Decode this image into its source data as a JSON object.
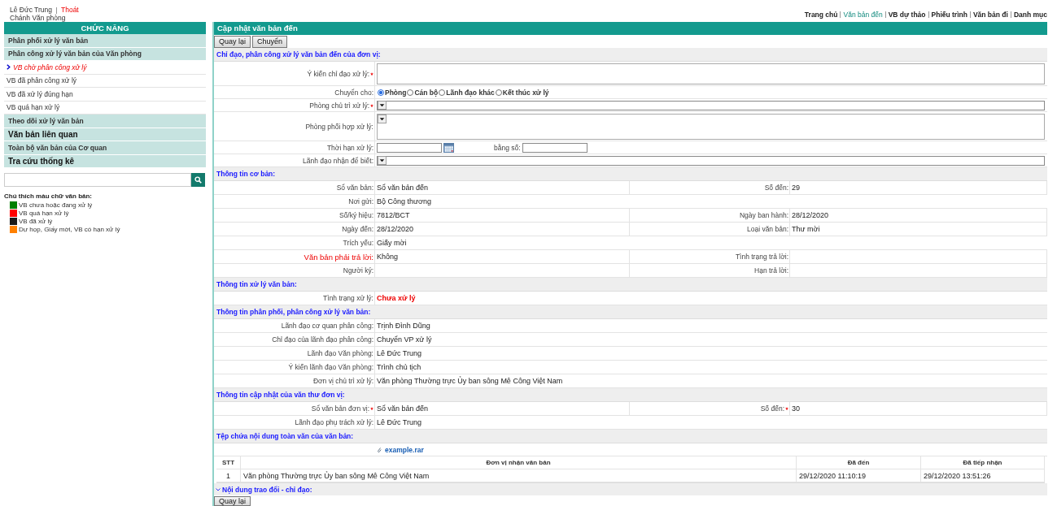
{
  "user": {
    "name": "Lê Đức Trung",
    "logout": "Thoát",
    "role": "Chánh Văn phòng"
  },
  "nav": [
    {
      "label": "Trang chủ",
      "selected": false
    },
    {
      "label": "Văn bản đến",
      "selected": true
    },
    {
      "label": "VB dự thảo",
      "selected": false
    },
    {
      "label": "Phiếu trình",
      "selected": false
    },
    {
      "label": "Văn bản đi",
      "selected": false
    },
    {
      "label": "Danh mục",
      "selected": false
    }
  ],
  "sidebar": {
    "title": "CHỨC NĂNG",
    "items": [
      {
        "label": "Phân phối xử lý văn bản",
        "kind": "group",
        "selected": false
      },
      {
        "label": "Phân công xử lý văn bản của Văn phòng",
        "kind": "group",
        "selected": false
      },
      {
        "label": "VB chờ phân công xử lý",
        "kind": "item",
        "selected": true
      },
      {
        "label": "VB đã phân công xử lý",
        "kind": "item",
        "selected": false
      },
      {
        "label": "VB đã xử lý đúng hạn",
        "kind": "item",
        "selected": false
      },
      {
        "label": "VB quá hạn xử lý",
        "kind": "item",
        "selected": false
      },
      {
        "label": "Theo dõi xử lý văn bản",
        "kind": "group",
        "selected": false
      },
      {
        "label": "Văn bản liên quan",
        "kind": "major",
        "selected": false
      },
      {
        "label": "Toàn bộ văn bản của Cơ quan",
        "kind": "group",
        "selected": false
      },
      {
        "label": "Tra cứu thống kê",
        "kind": "major",
        "selected": false
      }
    ],
    "legend": {
      "title": "Chú thích màu chữ văn bản:",
      "items": [
        {
          "label": "VB chưa hoặc đang xử lý",
          "color": "#008000"
        },
        {
          "label": "VB quá hạn xử lý",
          "color": "#ff0000"
        },
        {
          "label": "VB đã xử lý",
          "color": "#1a1a1a"
        },
        {
          "label": "Dự họp, Giấy mời, VB có hạn xử lý",
          "color": "#ff8000"
        }
      ]
    }
  },
  "main": {
    "title": "Cập nhật văn bản đến",
    "buttons": [
      "Quay lại",
      "Chuyển"
    ],
    "form": {
      "heading": "Chỉ đạo, phân công xử lý văn bản đến của đơn vị:",
      "fields": [
        {
          "label": "Ý kiến chỉ đạo xử lý:",
          "kind": "textarea",
          "required": true
        },
        {
          "label": "Chuyển cho:",
          "kind": "radios",
          "required": false,
          "options": [
            {
              "label": "Phòng",
              "selected": true
            },
            {
              "label": "Cán bộ",
              "selected": false
            },
            {
              "label": "Lãnh đạo khác",
              "selected": false
            },
            {
              "label": "Kết thúc xử lý",
              "selected": false
            }
          ]
        },
        {
          "label": "Phòng chủ trì xử lý:",
          "kind": "select",
          "required": true
        },
        {
          "label": "Phòng phối hợp xử lý:",
          "kind": "listbox",
          "required": false
        },
        {
          "label": "Thời hạn xử lý:",
          "kind": "date",
          "required": false,
          "extra_label": "bằng số:"
        },
        {
          "label": "Lãnh đạo nhận để biết:",
          "kind": "select",
          "required": false
        }
      ]
    },
    "sections": [
      {
        "kind": "fields",
        "heading": "Thông tin cơ bản:",
        "rows": [
          {
            "cells": [
              {
                "label": "Sổ văn bản:",
                "value": "Sổ văn bản đến"
              },
              {
                "label": "Số đến:",
                "value": "29"
              }
            ]
          },
          {
            "cells": [
              {
                "label": "Nơi gửi:",
                "value": "Bộ Công thương"
              }
            ]
          },
          {
            "cells": [
              {
                "label": "Số/ký hiệu:",
                "value": "7812/BCT"
              },
              {
                "label": "Ngày ban hành:",
                "value": "28/12/2020"
              }
            ]
          },
          {
            "cells": [
              {
                "label": "Ngày đến:",
                "value": "28/12/2020"
              },
              {
                "label": "Loại văn bản:",
                "value": "Thư mời"
              }
            ]
          },
          {
            "cells": [
              {
                "label": "Trích yếu:",
                "value": "Giấy mời"
              }
            ]
          },
          {
            "cells": [
              {
                "label": "Văn bản phải trả lời:",
                "value": "Không",
                "label_alert": true
              },
              {
                "label": "Tình trạng trả lời:"
              }
            ]
          },
          {
            "cells": [
              {
                "label": "Người ký:"
              },
              {
                "label": "Hạn trả lời:"
              }
            ]
          }
        ]
      },
      {
        "kind": "fields",
        "heading": "Thông tin xử lý văn bản:",
        "rows": [
          {
            "cells": [
              {
                "label": "Tình trạng xử lý:",
                "value": "Chưa xử lý",
                "value_alert": true
              }
            ]
          }
        ]
      },
      {
        "kind": "fields",
        "heading": "Thông tin phân phối, phân công xử lý văn bản:",
        "rows": [
          {
            "cells": [
              {
                "label": "Lãnh đạo cơ quan phân công:",
                "value": "Trịnh Đình Dũng"
              }
            ]
          },
          {
            "cells": [
              {
                "label": "Chỉ đạo của lãnh đạo phân công:",
                "value": "Chuyển VP xử lý"
              }
            ]
          },
          {
            "cells": [
              {
                "label": "Lãnh đạo Văn phòng:",
                "value": "Lê Đức Trung"
              }
            ]
          },
          {
            "cells": [
              {
                "label": "Ý kiến lãnh đạo Văn phòng:",
                "value": "Trình chủ tịch"
              }
            ]
          },
          {
            "cells": [
              {
                "label": "Đơn vị chủ trì xử lý:",
                "value": "Văn phòng Thường trực Ủy ban sông Mê Công Việt Nam"
              }
            ]
          }
        ]
      },
      {
        "kind": "fields",
        "heading": "Thông tin cập nhật của văn thư đơn vị:",
        "rows": [
          {
            "cells": [
              {
                "label": "Sổ văn bản đơn vị:",
                "value": "Sổ văn bản đến",
                "required": true
              },
              {
                "label": "Số đến:",
                "value": "30",
                "required": true
              }
            ]
          },
          {
            "cells": [
              {
                "label": "Lãnh đạo phụ trách xử lý:",
                "value": "Lê Đức Trung"
              }
            ]
          }
        ]
      },
      {
        "kind": "attachment",
        "heading": "Tệp chứa nội dung toàn văn của văn bản:",
        "file": "example.rar"
      },
      {
        "kind": "table",
        "columns": [
          "STT",
          "Đơn vị nhận văn bản",
          "Đã đến",
          "Đã tiếp nhận"
        ],
        "rows": [
          [
            "1",
            "Văn phòng Thường trực Ủy ban sông Mê Công Việt Nam",
            "29/12/2020 11:10:19",
            "29/12/2020 13:51:26"
          ]
        ]
      },
      {
        "kind": "collapsible",
        "heading": "Nội dung trao đổi - chỉ đạo:",
        "expanded": false
      }
    ],
    "footer_button": "Quay lại"
  }
}
